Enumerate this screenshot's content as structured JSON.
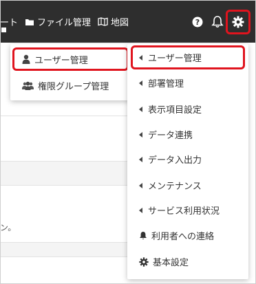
{
  "navbar": {
    "partial_label": "ート",
    "file_mgmt_label": "ファイル管理",
    "map_label": "地図",
    "icons": [
      "folder-icon",
      "map-icon",
      "help-icon",
      "bell-icon",
      "gear-icon"
    ]
  },
  "background": {
    "partial_text": "ン。"
  },
  "user_menu": {
    "items": [
      {
        "label": "ユーザー管理",
        "icon": "user-icon"
      },
      {
        "label": "権限グループ管理",
        "icon": "users-icon"
      }
    ]
  },
  "settings_menu": {
    "items": [
      {
        "label": "ユーザー管理"
      },
      {
        "label": "部署管理"
      },
      {
        "label": "表示項目設定"
      },
      {
        "label": "データ連携"
      },
      {
        "label": "データ入出力"
      },
      {
        "label": "メンテナンス"
      },
      {
        "label": "サービス利用状況"
      },
      {
        "label": "利用者への連絡",
        "icon": "bell-icon"
      },
      {
        "label": "基本設定",
        "icon": "gear-icon"
      }
    ]
  },
  "colors": {
    "navbar": "#2e2e2e",
    "highlight": "#e0141e"
  }
}
